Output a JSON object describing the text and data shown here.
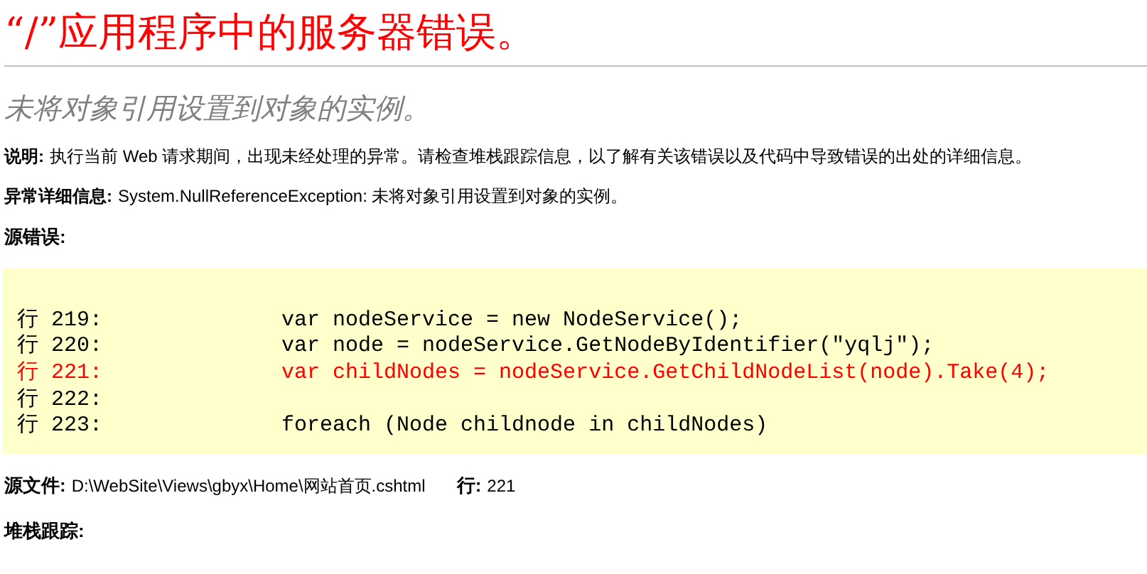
{
  "title": "“/”应用程序中的服务器错误。",
  "subtitle": "未将对象引用设置到对象的实例。",
  "details": [
    {
      "label": "说明:",
      "text": "执行当前 Web 请求期间，出现未经处理的异常。请检查堆栈跟踪信息，以了解有关该错误以及代码中导致错误的出处的详细信息。"
    },
    {
      "label": "异常详细信息:",
      "text": "System.NullReferenceException: 未将对象引用设置到对象的实例。"
    }
  ],
  "source_error": {
    "heading": "源错误:",
    "lines": [
      {
        "text": "行 219:              var nodeService = new NodeService();",
        "highlighted": false
      },
      {
        "text": "行 220:              var node = nodeService.GetNodeByIdentifier(\"yqlj\");",
        "highlighted": false
      },
      {
        "text": "行 221:              var childNodes = nodeService.GetChildNodeList(node).Take(4);",
        "highlighted": true
      },
      {
        "text": "行 222:",
        "highlighted": false
      },
      {
        "text": "行 223:              foreach (Node childnode in childNodes)",
        "highlighted": false
      }
    ]
  },
  "source_file": {
    "label": "源文件:",
    "path": "D:\\WebSite\\Views\\gbyx\\Home\\网站首页.cshtml",
    "line_label": "行:",
    "line": "221"
  },
  "stack_trace": {
    "heading": "堆栈跟踪:"
  }
}
